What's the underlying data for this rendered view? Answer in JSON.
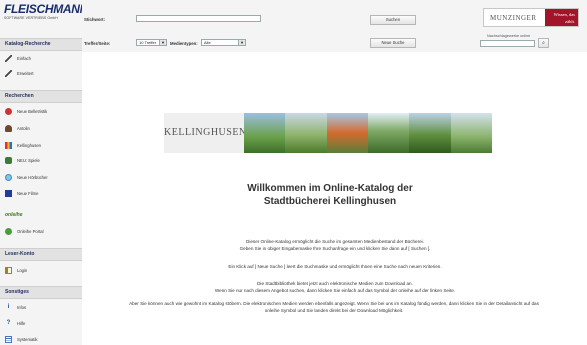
{
  "logo": {
    "brand": "FLEISCHMANN",
    "subtitle": "SOFTWARE VERTRIEBS GmbH"
  },
  "search": {
    "stichwort_label": "Stichwort:",
    "treffer_label": "Treffer/Seite:",
    "treffer_value": "10 Treffer",
    "medientypen_label": "Medientypen:",
    "medientypen_value": "Alle",
    "suchen_button": "Suchen",
    "neue_suche_button": "Neue Suche"
  },
  "munzinger": {
    "name": "MUNZINGER",
    "tagline": "Wissen, das zählt.",
    "lookup_label": "Nachschlagewerke online"
  },
  "sidebar": {
    "katalog_header": "Katalog-Recherche",
    "katalog_items": [
      {
        "label": "Einfach",
        "icon": "pencil-icon"
      },
      {
        "label": "Erweitert",
        "icon": "pencil-icon"
      }
    ],
    "recherchen_header": "Recherchen",
    "recherchen_items": [
      {
        "label": "Neue Belletristik",
        "icon": "apple-icon"
      },
      {
        "label": "Antolin",
        "icon": "person-icon"
      },
      {
        "label": "Kellinghusen",
        "icon": "books-icon"
      },
      {
        "label": "NEU: Spiele",
        "icon": "game-icon"
      },
      {
        "label": "Neue Hörbücher",
        "icon": "globe-icon"
      },
      {
        "label": "Neue Filme",
        "icon": "film-icon"
      }
    ],
    "onleihe_logo": "onleihe",
    "onleihe_item": {
      "label": "Onleihe Portal",
      "icon": "portal-icon"
    },
    "leser_header": "Leser-Konto",
    "leser_item": {
      "label": "Login",
      "icon": "key-icon"
    },
    "sonstiges_header": "Sonstiges",
    "sonstiges_items": [
      {
        "label": "Infos",
        "icon": "info-icon"
      },
      {
        "label": "Hilfe",
        "icon": "help-icon"
      },
      {
        "label": "Systematik",
        "icon": "list-icon"
      }
    ]
  },
  "banner": {
    "title": "KELLINGHUSEN"
  },
  "welcome": {
    "line1": "Willkommen im Online-Katalog der",
    "line2": "Stadtbücherei Kellinghusen"
  },
  "paragraphs": {
    "p1_line1": "Dieser Online-Katalog ermöglicht die Suche im gesamten Medienbestand der Bücherei.",
    "p1_line2": "Geben Sie in obiger Eingabemaske Ihre Suchanfrage ein und klicken Sie dann auf [ Suchen ].",
    "p2": "Ein Klick auf [ Neue Suche ] leert die Suchmaske und ermöglicht Ihnen eine Suche nach neuen Kriterien.",
    "p3_line1": "Die Stadtbibliothek bietet jetzt auch elektronische Medien zum Download an.",
    "p3_line2": "Wenn Sie nur nach diesem Angebot suchen, dann klicken Sie einfach auf das Symbol der onleihe auf der linken Seite.",
    "p4_line1": "Aber Sie können auch wie gewohnt im Katalog stöbern. Die elektronischen Medien werden ebenfalls angezeigt. Wenn Sie bei uns im Katalog fündig werden, dann klicken Sie in der Detailansicht auf das",
    "p4_line2": "onleihe Symbol und Sie landen direkt bei der Download Möglichkeit."
  }
}
